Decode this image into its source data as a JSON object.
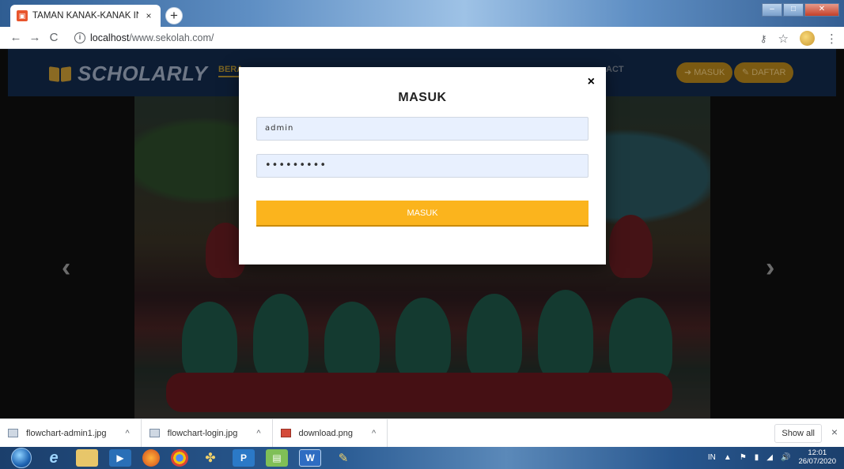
{
  "browser": {
    "tab_title": "TAMAN KANAK-KANAK INSANI",
    "tab_close": "×",
    "new_tab": "+",
    "url_host": "localhost",
    "url_path": "/www.sekolah.com/"
  },
  "site": {
    "logo": "SCHOLARLY",
    "nav_home": "BERA",
    "nav_contact": "ACT",
    "masuk_button": "➜ MASUK",
    "daftar_button": "✎ DAFTAR"
  },
  "modal": {
    "close": "×",
    "title": "MASUK",
    "username_value": "admin",
    "password_value": "•••••••••",
    "submit_label": "MASUK"
  },
  "carousel": {
    "prev": "‹",
    "next": "›"
  },
  "downloads": {
    "items": [
      {
        "name": "flowchart-admin1.jpg"
      },
      {
        "name": "flowchart-login.jpg"
      },
      {
        "name": "download.png"
      }
    ],
    "show_all": "Show all",
    "close": "×"
  },
  "taskbar": {
    "lang": "IN",
    "time": "12:01",
    "date": "26/07/2020"
  },
  "colors": {
    "accent": "#fbb41d",
    "nav_bg": "#0c1c33",
    "field_bg": "#e8f0fe"
  }
}
